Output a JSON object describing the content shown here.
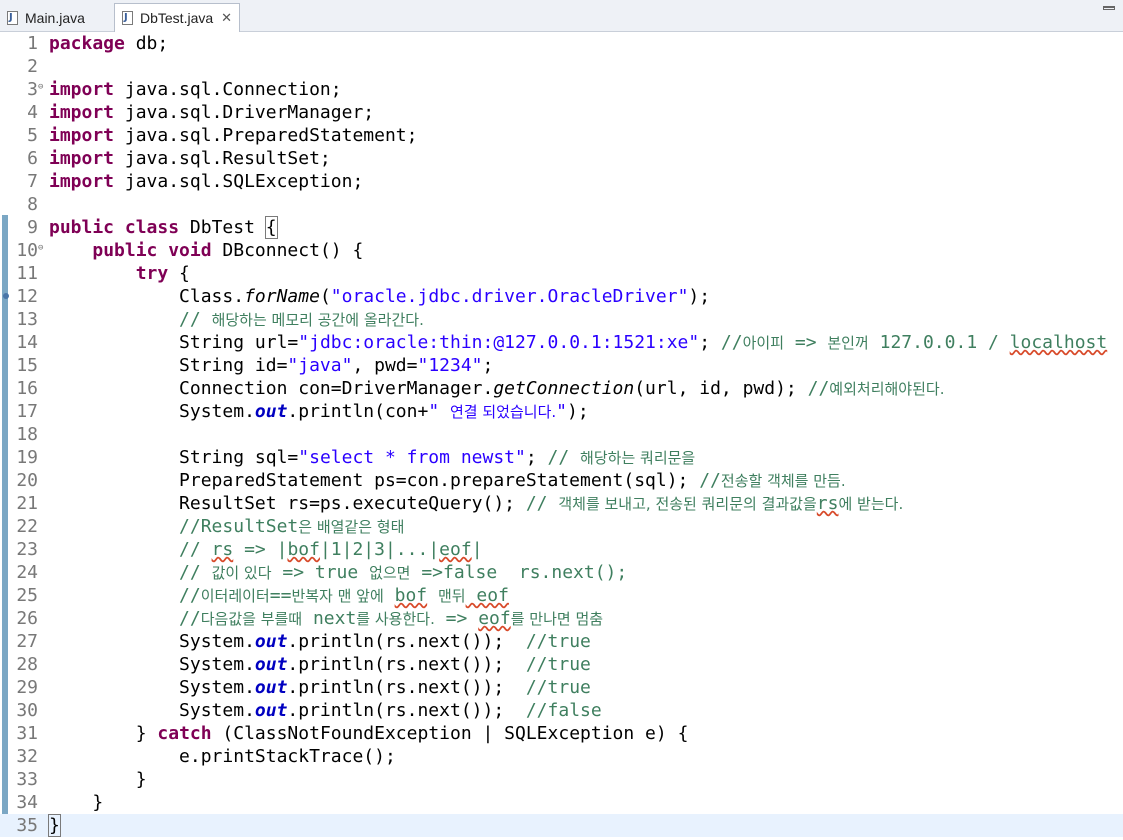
{
  "tabs": [
    {
      "label": "Main.java",
      "icon": "java-file-icon"
    },
    {
      "label": "DbTest.java",
      "icon": "java-file-icon",
      "close": "✕"
    }
  ],
  "code": {
    "l1": {
      "kw": "package",
      "rest": " db;"
    },
    "l3": {
      "kw": "import",
      "rest": " java.sql.Connection;"
    },
    "l4": {
      "kw": "import",
      "rest": " java.sql.DriverManager;"
    },
    "l5": {
      "kw": "import",
      "rest": " java.sql.PreparedStatement;"
    },
    "l6": {
      "kw": "import",
      "rest": " java.sql.ResultSet;"
    },
    "l7": {
      "kw": "import",
      "rest": " java.sql.SQLException;"
    },
    "l9": {
      "kw": "public class",
      "sp": " ",
      "name": "DbTest",
      "brace": "{"
    },
    "l10": {
      "kw": "public void",
      "rest": " DBconnect() {"
    },
    "l11": {
      "kw": "try",
      "rest": " {"
    },
    "l12": {
      "a": "Class.",
      "m": "forName",
      "b": "(",
      "s": "\"oracle.jdbc.driver.OracleDriver\"",
      "c": ");"
    },
    "l13": {
      "c1": "// ",
      "k": "해당하는 메모리 공간에 올라간다."
    },
    "l14": {
      "a": "String url=",
      "s": "\"jdbc:oracle:thin:@127.0.0.1:1521:xe\"",
      "b": "; ",
      "c1": "//",
      "k": "아이피",
      "c2": " => ",
      "k2": "본인꺼",
      "c3": " 127.0.0.1 / ",
      "c4": "localhost"
    },
    "l15": {
      "a": "String id=",
      "s1": "\"java\"",
      "b": ", pwd=",
      "s2": "\"1234\"",
      "c": ";"
    },
    "l16": {
      "a": "Connection con=DriverManager.",
      "m": "getConnection",
      "b": "(url, id, pwd); ",
      "c1": "//",
      "k": "예외처리해야된다."
    },
    "l17": {
      "a": "System.",
      "f": "out",
      "b": ".println(con+",
      "s": "\" ",
      "k": "연결 되었습니다.",
      "s2": "\"",
      "c": ");"
    },
    "l19": {
      "a": "String sql=",
      "s": "\"select * from newst\"",
      "b": "; ",
      "c1": "// ",
      "k": "해당하는 쿼리문을"
    },
    "l20": {
      "a": "PreparedStatement ps=con.prepareStatement(sql); ",
      "c1": "//",
      "k": "전송할 객체를 만듬."
    },
    "l21": {
      "a": "ResultSet rs=ps.executeQuery(); ",
      "c1": "// ",
      "k": "객체를 보내고, 전송된 쿼리문의 결과값을",
      "c2": "rs",
      "k2": "에 받는다."
    },
    "l22": {
      "c1": "//ResultSet",
      "k": "은 배열같은 형태"
    },
    "l23": {
      "c1": "// ",
      "c2": "rs",
      "c3": " => |",
      "c4": "bof",
      "c5": "|1|2|3|...|",
      "c6": "eof",
      "c7": "|"
    },
    "l24": {
      "c1": "// ",
      "k": "값이 있다",
      "c2": " => true ",
      "k2": "없으면",
      "c3": " =>false  rs.next();"
    },
    "l25": {
      "c1": "//",
      "k": "이터레이터",
      "c2": "==",
      "k2": "반복자 맨 앞에",
      "c3": " ",
      "c4": "bof",
      "c5": " ",
      "k3": "맨뒤",
      "c6": " eof"
    },
    "l26": {
      "c1": "//",
      "k": "다음값을 부를때",
      "c2": " next",
      "k2": "를 사용한다.",
      "c3": " => ",
      "c4": "eof",
      "k3": "를 만나면 멈춤"
    },
    "l27": {
      "a": "System.",
      "f": "out",
      "b": ".println(rs.next());  ",
      "c": "//true"
    },
    "l28": {
      "a": "System.",
      "f": "out",
      "b": ".println(rs.next());  ",
      "c": "//true"
    },
    "l29": {
      "a": "System.",
      "f": "out",
      "b": ".println(rs.next());  ",
      "c": "//true"
    },
    "l30": {
      "a": "System.",
      "f": "out",
      "b": ".println(rs.next());  ",
      "c": "//false"
    },
    "l31": {
      "a": "} ",
      "kw": "catch",
      "b": " (ClassNotFoundException | SQLException e) {"
    },
    "l32": {
      "a": "e.printStackTrace();"
    },
    "l33": {
      "a": "}"
    },
    "l34": {
      "a": "}"
    },
    "l35": {
      "a": "}"
    }
  }
}
